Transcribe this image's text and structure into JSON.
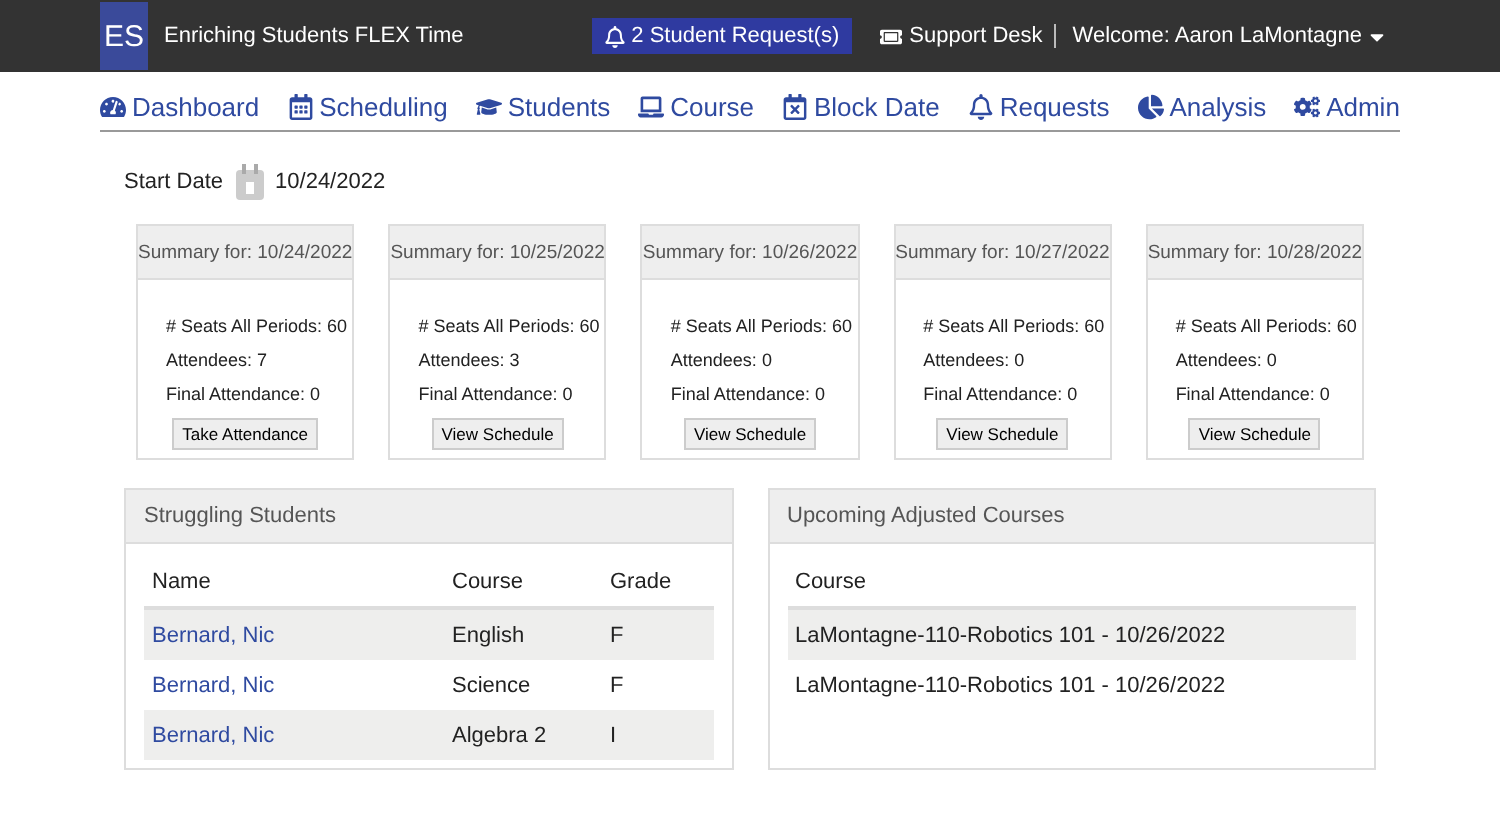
{
  "header": {
    "logo": "ES",
    "title": "Enriching Students FLEX Time",
    "requests": "2 Student Request(s)",
    "support": "Support Desk",
    "welcome": "Welcome:  Aaron LaMontagne"
  },
  "nav": [
    "Dashboard",
    "Scheduling",
    "Students",
    "Course",
    "Block Date",
    "Requests",
    "Analysis",
    "Admin"
  ],
  "start_date": {
    "label": "Start Date",
    "value": "10/24/2022"
  },
  "summaries": [
    {
      "title": "Summary for: 10/24/2022",
      "seats": "# Seats All Periods: 60",
      "attendees": "Attendees: 7",
      "final": "Final Attendance: 0",
      "button": "Take Attendance"
    },
    {
      "title": "Summary for: 10/25/2022",
      "seats": "# Seats All Periods: 60",
      "attendees": "Attendees: 3",
      "final": "Final Attendance: 0",
      "button": "View Schedule"
    },
    {
      "title": "Summary for: 10/26/2022",
      "seats": "# Seats All Periods: 60",
      "attendees": "Attendees: 0",
      "final": "Final Attendance: 0",
      "button": "View Schedule"
    },
    {
      "title": "Summary for: 10/27/2022",
      "seats": "# Seats All Periods: 60",
      "attendees": "Attendees: 0",
      "final": "Final Attendance: 0",
      "button": "View Schedule"
    },
    {
      "title": "Summary for: 10/28/2022",
      "seats": "# Seats All Periods: 60",
      "attendees": "Attendees: 0",
      "final": "Final Attendance: 0",
      "button": "View Schedule"
    }
  ],
  "struggling_students": {
    "title": "Struggling Students",
    "columns": [
      "Name",
      "Course",
      "Grade"
    ],
    "rows": [
      {
        "name": "Bernard, Nic",
        "course": "English",
        "grade": "F"
      },
      {
        "name": "Bernard, Nic",
        "course": "Science",
        "grade": "F"
      },
      {
        "name": "Bernard, Nic",
        "course": "Algebra 2",
        "grade": "I"
      }
    ]
  },
  "upcoming_courses": {
    "title": "Upcoming Adjusted Courses",
    "columns": [
      "Course"
    ],
    "rows": [
      "LaMontagne-110-Robotics 101 - 10/26/2022",
      "LaMontagne-110-Robotics 101 - 10/26/2022"
    ]
  }
}
